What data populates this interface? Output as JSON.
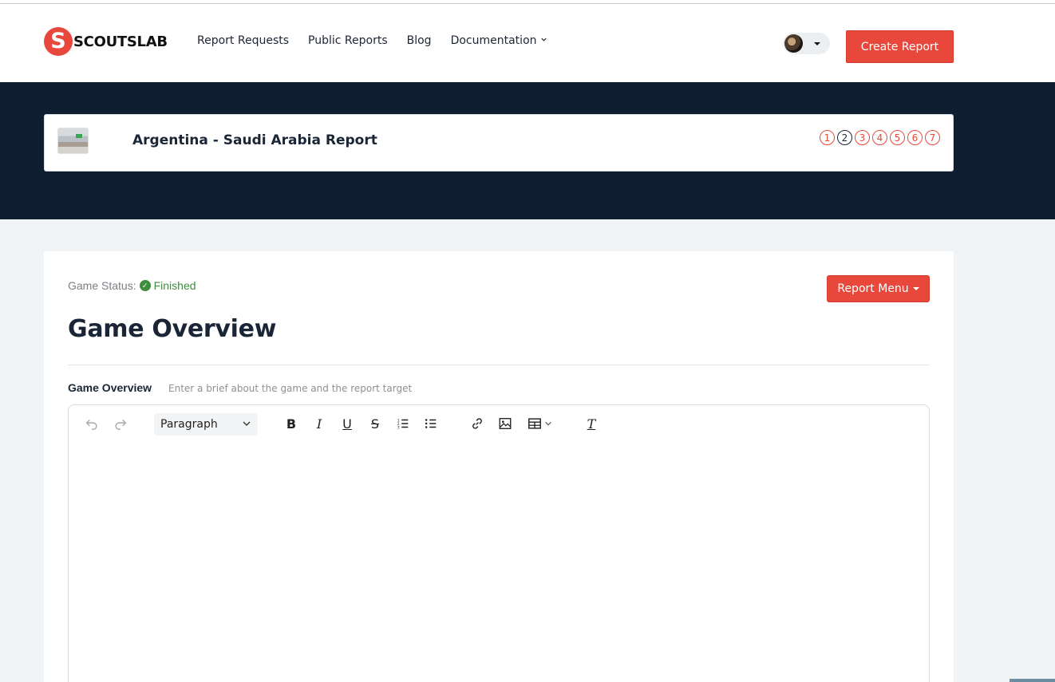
{
  "brand": {
    "logo_letter": "S",
    "name": "SCOUTSLAB"
  },
  "nav": {
    "items": [
      {
        "label": "Report Requests"
      },
      {
        "label": "Public Reports"
      },
      {
        "label": "Blog"
      },
      {
        "label": "Documentation"
      }
    ],
    "create_button": "Create Report"
  },
  "report": {
    "title": "Argentina - Saudi Arabia Report",
    "steps": [
      "1",
      "2",
      "3",
      "4",
      "5",
      "6",
      "7"
    ],
    "active_step": 2
  },
  "content": {
    "status_label": "Game Status:",
    "status_value": "Finished",
    "report_menu": "Report Menu",
    "heading": "Game Overview",
    "field_label": "Game Overview",
    "field_hint": "Enter a brief about the game and the report target"
  },
  "editor": {
    "block_format": "Paragraph",
    "tools": [
      "undo-icon",
      "redo-icon",
      "bold-icon",
      "italic-icon",
      "underline-icon",
      "strikethrough-icon",
      "numbered-list-icon",
      "bulleted-list-icon",
      "link-icon",
      "image-icon",
      "table-icon",
      "clear-formatting-icon"
    ],
    "bold_glyph": "B",
    "italic_glyph": "I",
    "underline_glyph": "U",
    "strike_glyph": "S",
    "clear_glyph": "T"
  },
  "colors": {
    "accent": "#e8483b",
    "hero_bg": "#0e1d2f",
    "status_green": "#3d8f3d"
  }
}
